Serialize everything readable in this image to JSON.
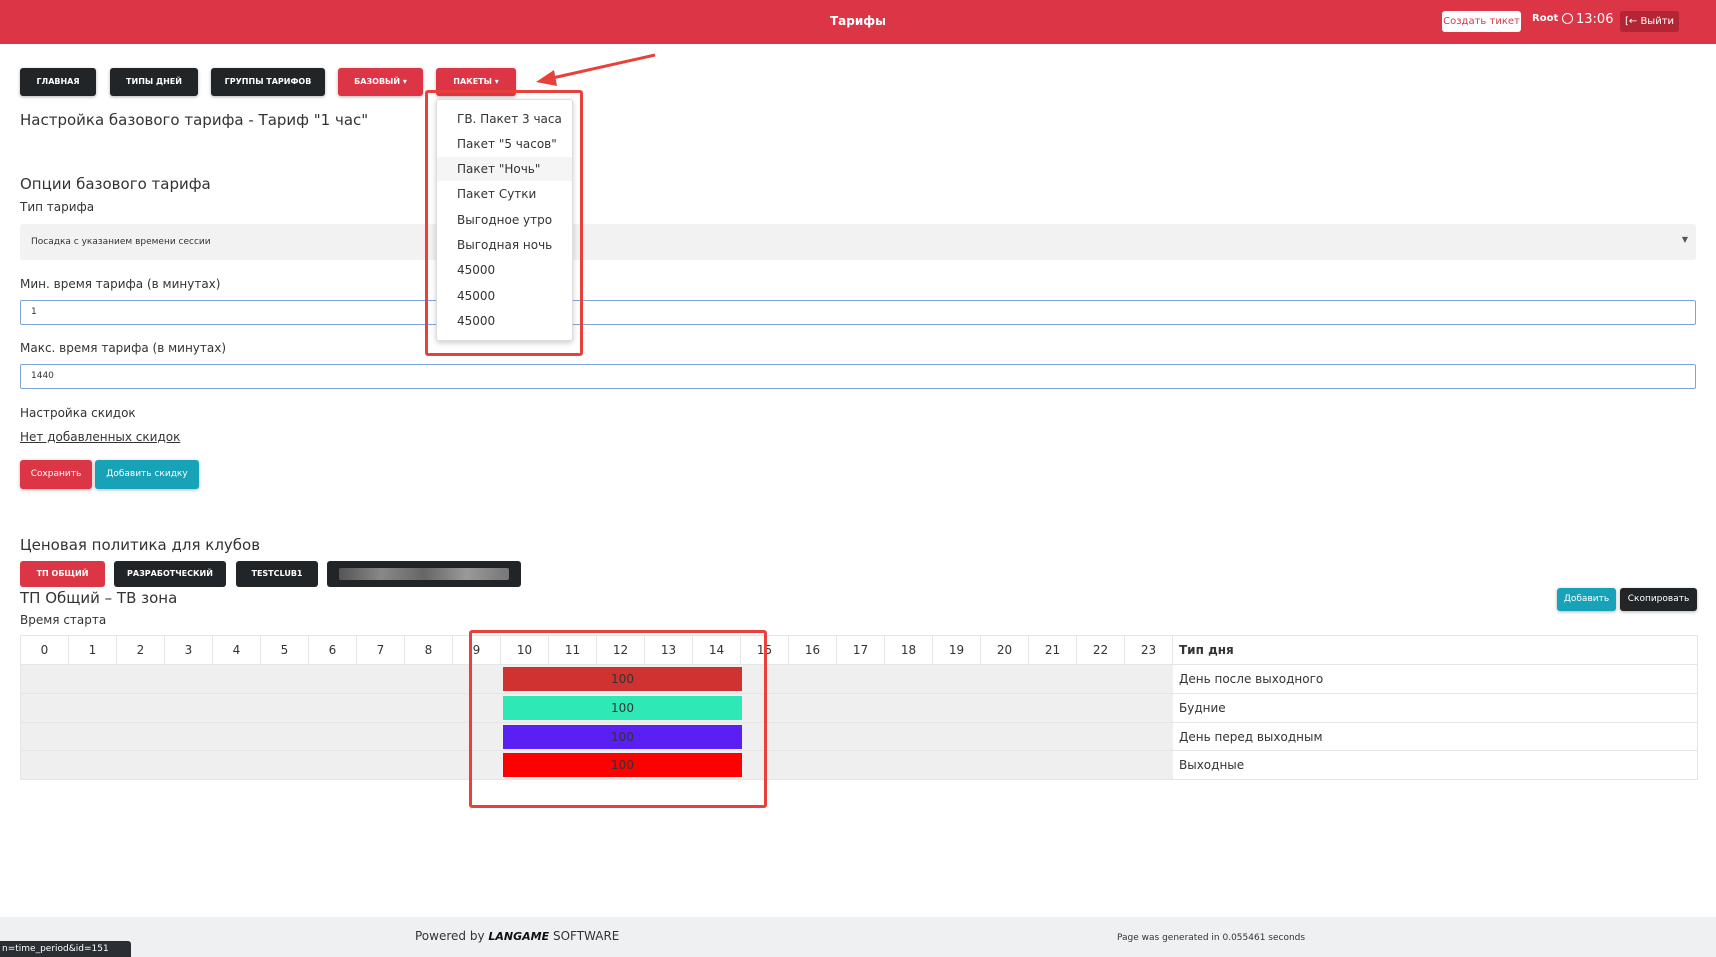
{
  "header": {
    "title": "Тарифы",
    "create_ticket": "Создать тикет",
    "user": "Root",
    "time": "13:06",
    "logout": "Выйти"
  },
  "nav": {
    "main": "ГЛАВНАЯ",
    "day_types": "ТИПЫ ДНЕЙ",
    "tariff_groups": "ГРУППЫ ТАРИФОВ",
    "basic": "БАЗОВЫЙ ▾",
    "packages": "ПАКЕТЫ ▾"
  },
  "packages_menu": [
    "ГВ. Пакет 3 часа",
    "Пакет \"5 часов\"",
    "Пакет \"Ночь\"",
    "Пакет Сутки",
    "Выгодное утро",
    "Выгодная ночь",
    "45000",
    "45000",
    "45000"
  ],
  "page": {
    "title": "Настройка базового тарифа - Тариф \"1 час\"",
    "options_heading": "Опции базового тарифа",
    "tariff_type_label": "Тип тарифа",
    "tariff_type_value": "Посадка с указанием времени сессии",
    "min_time_label": "Мин. время тарифа (в минутах)",
    "min_time_value": "1",
    "max_time_label": "Макс. время тарифа (в минутах)",
    "max_time_value": "1440",
    "discounts_label": "Настройка скидок",
    "no_discounts_link": "Нет добавленных скидок",
    "save_button": "Сохранить",
    "add_discount_button": "Добавить скидку"
  },
  "clubs": {
    "heading": "Ценовая политика для клубов",
    "buttons": [
      "ТП ОБЩИЙ",
      "РАЗРАБОТЧЕСКИЙ",
      "TESTCLUB1"
    ]
  },
  "zone": {
    "title": "ТП Общий – ТВ зона",
    "start_time_label": "Время старта",
    "add_button": "Добавить",
    "copy_button": "Скопировать",
    "day_type_header": "Тип дня",
    "hours": [
      "0",
      "1",
      "2",
      "3",
      "4",
      "5",
      "6",
      "7",
      "8",
      "9",
      "10",
      "11",
      "12",
      "13",
      "14",
      "15",
      "16",
      "17",
      "18",
      "19",
      "20",
      "21",
      "22",
      "23"
    ],
    "rows": [
      {
        "day": "День после выходного",
        "price": "100",
        "color": "#d03232"
      },
      {
        "day": "Будние",
        "price": "100",
        "color": "#2ee8b6"
      },
      {
        "day": "День перед выходным",
        "price": "100",
        "color": "#5a1ff2"
      },
      {
        "day": "Выходные",
        "price": "100",
        "color": "#ff0000"
      }
    ]
  },
  "footer": {
    "powered_by": "Powered by",
    "brand": "LANGAME",
    "software": "SOFTWARE",
    "generated": "Page was generated in 0.055461 seconds",
    "status_url": "n=time_period&id=151"
  }
}
